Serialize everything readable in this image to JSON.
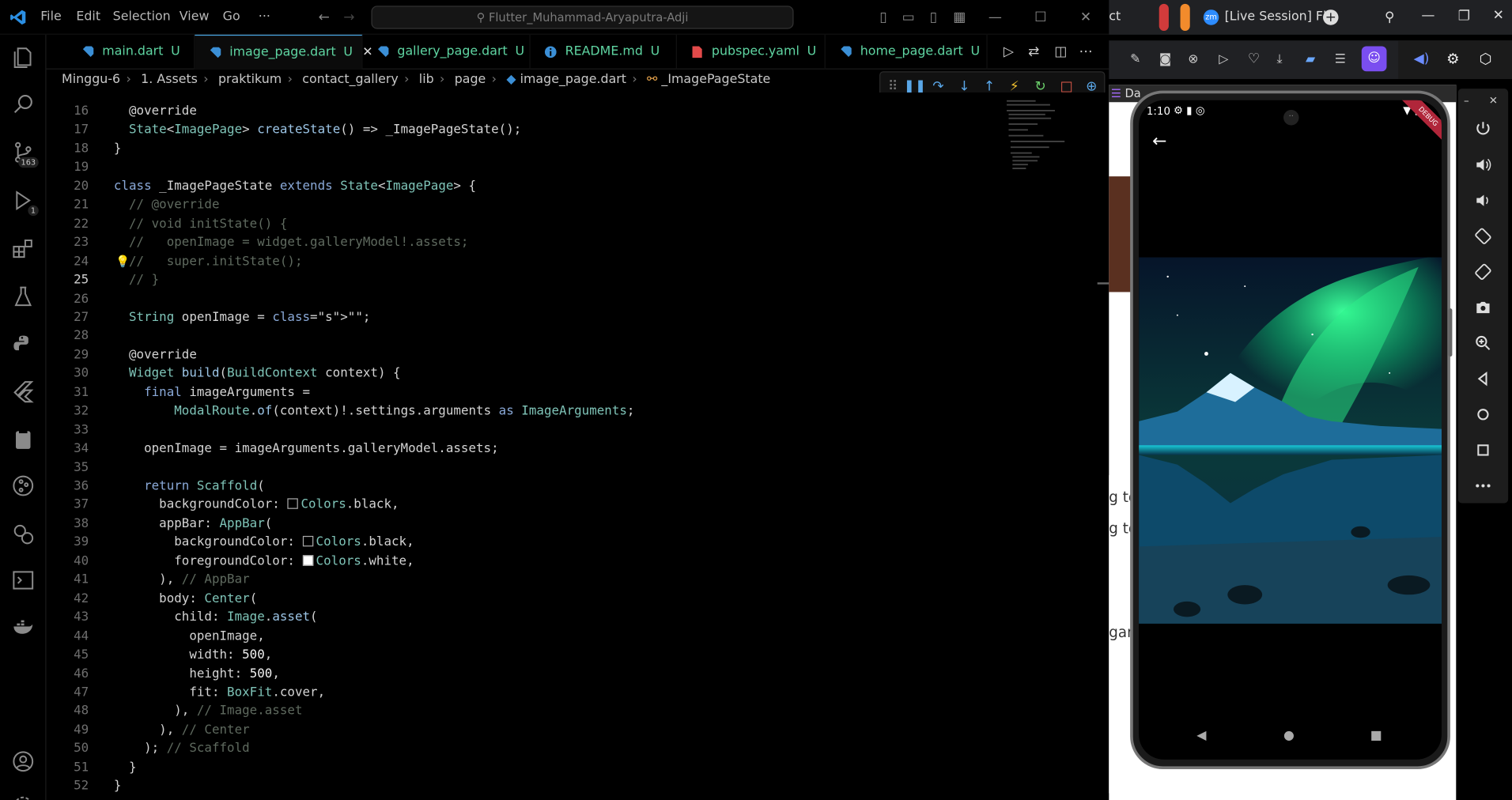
{
  "window": {
    "search_title": "Flutter_Muhammad-Aryaputra-Adji",
    "menu": [
      "File",
      "Edit",
      "Selection",
      "View",
      "Go",
      "···"
    ]
  },
  "activity_badges": {
    "source_control": "163",
    "run_debug": "1"
  },
  "tabs": [
    {
      "label": "main.dart",
      "tag": "U",
      "icon": "dart-icon"
    },
    {
      "label": "image_page.dart",
      "tag": "U",
      "icon": "dart-icon",
      "active": true
    },
    {
      "label": "gallery_page.dart",
      "tag": "U",
      "icon": "dart-icon"
    },
    {
      "label": "README.md",
      "tag": "U",
      "icon": "info-icon"
    },
    {
      "label": "pubspec.yaml",
      "tag": "U",
      "icon": "yaml-icon"
    },
    {
      "label": "home_page.dart",
      "tag": "U",
      "icon": "dart-icon"
    }
  ],
  "breadcrumb": [
    "Minggu-6",
    "1. Assets",
    "praktikum",
    "contact_gallery",
    "lib",
    "page",
    "image_page.dart",
    "_ImagePageState"
  ],
  "editor": {
    "current_line": 25,
    "lines": [
      {
        "n": "16",
        "code": "  @override"
      },
      {
        "n": "17",
        "code": "  State<ImagePage> createState() => _ImagePageState();"
      },
      {
        "n": "18",
        "code": "}"
      },
      {
        "n": "19",
        "code": ""
      },
      {
        "n": "20",
        "code": "class _ImagePageState extends State<ImagePage> {"
      },
      {
        "n": "21",
        "code": "  // @override"
      },
      {
        "n": "22",
        "code": "  // void initState() {"
      },
      {
        "n": "23",
        "code": "  //   openImage = widget.galleryModel!.assets;"
      },
      {
        "n": "24",
        "code": "  //   super.initState();"
      },
      {
        "n": "25",
        "code": "  // }"
      },
      {
        "n": "26",
        "code": ""
      },
      {
        "n": "27",
        "code": "  String openImage = \"\";"
      },
      {
        "n": "28",
        "code": ""
      },
      {
        "n": "29",
        "code": "  @override"
      },
      {
        "n": "30",
        "code": "  Widget build(BuildContext context) {"
      },
      {
        "n": "31",
        "code": "    final imageArguments ="
      },
      {
        "n": "32",
        "code": "        ModalRoute.of(context)!.settings.arguments as ImageArguments;"
      },
      {
        "n": "33",
        "code": ""
      },
      {
        "n": "34",
        "code": "    openImage = imageArguments.galleryModel.assets;"
      },
      {
        "n": "35",
        "code": ""
      },
      {
        "n": "36",
        "code": "    return Scaffold("
      },
      {
        "n": "37",
        "code": "      backgroundColor: Colors.black,"
      },
      {
        "n": "38",
        "code": "      appBar: AppBar("
      },
      {
        "n": "39",
        "code": "        backgroundColor: Colors.black,"
      },
      {
        "n": "40",
        "code": "        foregroundColor: Colors.white,"
      },
      {
        "n": "41",
        "code": "      ), // AppBar"
      },
      {
        "n": "42",
        "code": "      body: Center("
      },
      {
        "n": "43",
        "code": "        child: Image.asset("
      },
      {
        "n": "44",
        "code": "          openImage,"
      },
      {
        "n": "45",
        "code": "          width: 500,"
      },
      {
        "n": "46",
        "code": "          height: 500,"
      },
      {
        "n": "47",
        "code": "          fit: BoxFit.cover,"
      },
      {
        "n": "48",
        "code": "        ), // Image.asset"
      },
      {
        "n": "49",
        "code": "      ), // Center"
      },
      {
        "n": "50",
        "code": "    ); // Scaffold"
      },
      {
        "n": "51",
        "code": "  }"
      },
      {
        "n": "52",
        "code": "}"
      }
    ]
  },
  "browser": {
    "tab_partial": "ct",
    "zoom_tab": "[Live Session] Fl",
    "page_fragments": [
      "Da",
      "g te",
      "g te",
      "gan"
    ]
  },
  "emulator": {
    "time": "1:10",
    "debug_banner": "DEBUG"
  },
  "colors": {
    "accent_blue": "#4aa8e6",
    "untracked_green": "#5fd5a2",
    "zoom_blue": "#2d8cff"
  }
}
